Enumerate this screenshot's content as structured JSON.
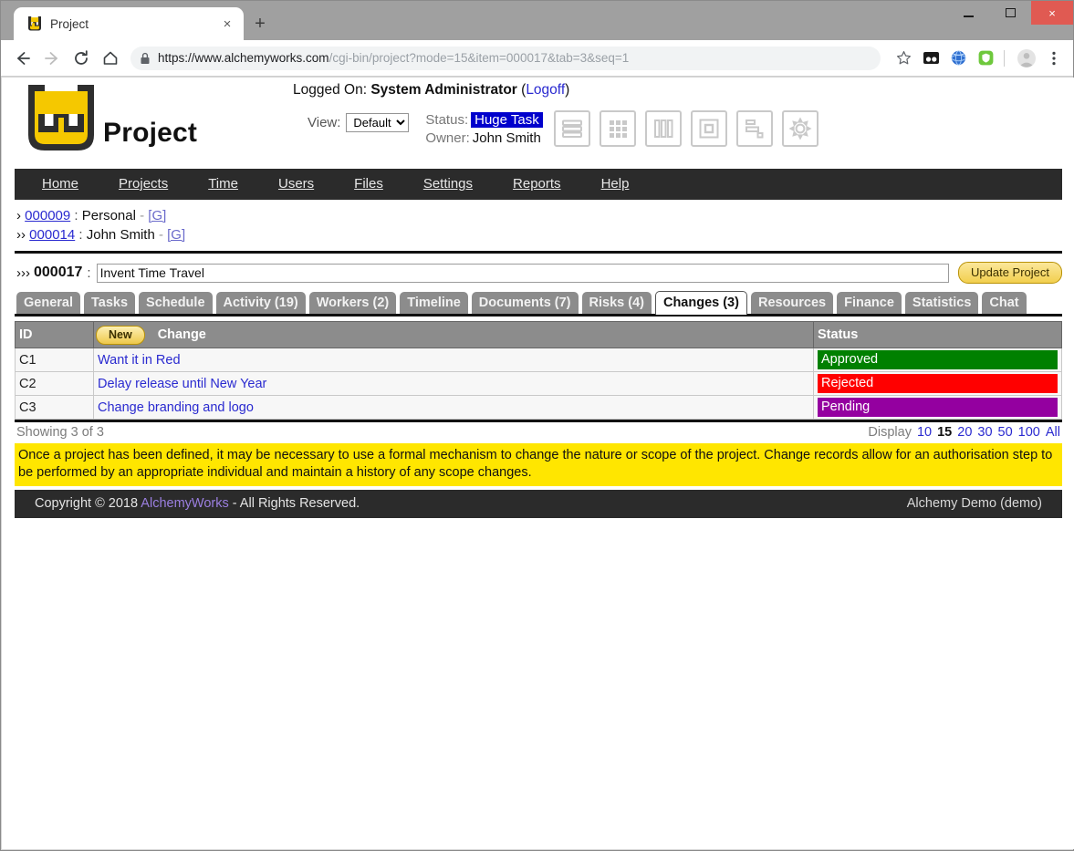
{
  "browser": {
    "tab_title": "Project",
    "tab_favicon": "project-logo-icon",
    "close_tab_label": "×",
    "new_tab_label": "+",
    "window_minimize": "minimize-icon",
    "window_maximize": "maximize-icon",
    "window_close": "×",
    "back_label": "←",
    "forward_label": "→",
    "reload_label": "⟳",
    "home_label": "⌂",
    "url_secure": "https://www.alchemyworks.com",
    "url_path": "/cgi-bin/project?mode=15&item=000017&tab=3&seq=1",
    "bookmark_label": "☆",
    "menu_label": "⋮"
  },
  "header": {
    "logo_text": "Project",
    "logged_on_label": "Logged On:",
    "user_name": "System Administrator",
    "logoff_open": "(",
    "logoff_label": "Logoff",
    "logoff_close": ")",
    "view_label": "View:",
    "view_value": "Default",
    "view_options": [
      "Default"
    ],
    "status_label": "Status:",
    "status_value": "Huge Task",
    "status_color": "#0000CC",
    "owner_label": "Owner:",
    "owner_value": "John Smith",
    "view_icons": [
      "list-view-icon",
      "grid-view-icon",
      "column-view-icon",
      "box-view-icon",
      "gantt-view-icon",
      "settings-gear-icon"
    ]
  },
  "nav": {
    "items": [
      {
        "label": "Home"
      },
      {
        "label": "Projects"
      },
      {
        "label": "Time"
      },
      {
        "label": "Users"
      },
      {
        "label": "Files"
      },
      {
        "label": "Settings"
      },
      {
        "label": "Reports"
      },
      {
        "label": "Help"
      }
    ]
  },
  "breadcrumbs": [
    {
      "arrow": "›",
      "id": "000009",
      "sep": ":",
      "name": "Personal",
      "dash": "-",
      "group": "[G]"
    },
    {
      "arrow": "››",
      "id": "000014",
      "sep": ":",
      "name": "John Smith",
      "dash": "-",
      "group": "[G]"
    }
  ],
  "project": {
    "chevron": "›››",
    "id": "000017",
    "sep": ":",
    "name_value": "Invent Time Travel",
    "name_placeholder": "",
    "update_button": "Update Project"
  },
  "tabs": [
    {
      "label": "General",
      "active": false
    },
    {
      "label": "Tasks",
      "active": false
    },
    {
      "label": "Schedule",
      "active": false
    },
    {
      "label": "Activity (19)",
      "active": false
    },
    {
      "label": "Workers (2)",
      "active": false
    },
    {
      "label": "Timeline",
      "active": false
    },
    {
      "label": "Documents (7)",
      "active": false
    },
    {
      "label": "Risks (4)",
      "active": false
    },
    {
      "label": "Changes (3)",
      "active": true
    },
    {
      "label": "Resources",
      "active": false
    },
    {
      "label": "Finance",
      "active": false
    },
    {
      "label": "Statistics",
      "active": false
    },
    {
      "label": "Chat",
      "active": false
    }
  ],
  "table": {
    "col_id": "ID",
    "new_button": "New",
    "col_change": "Change",
    "col_status": "Status",
    "rows": [
      {
        "id": "C1",
        "change": "Want it in Red",
        "status": "Approved",
        "status_color": "#008000"
      },
      {
        "id": "C2",
        "change": "Delay release until New Year",
        "status": "Rejected",
        "status_color": "#FF0000"
      },
      {
        "id": "C3",
        "change": "Change branding and logo",
        "status": "Pending",
        "status_color": "#9400A0"
      }
    ],
    "showing": "Showing 3 of 3",
    "display_label": "Display",
    "display_options": [
      {
        "label": "10",
        "current": false
      },
      {
        "label": "15",
        "current": true
      },
      {
        "label": "20",
        "current": false
      },
      {
        "label": "30",
        "current": false
      },
      {
        "label": "50",
        "current": false
      },
      {
        "label": "100",
        "current": false
      },
      {
        "label": "All",
        "current": false
      }
    ]
  },
  "info_banner": "Once a project has been defined, it may be necessary to use a formal mechanism to change the nature or scope of the project. Change records allow for an authorisation step to be performed by an appropriate individual and maintain a history of any scope changes.",
  "footer": {
    "copyright_pre": "Copyright © 2018",
    "brand": "AlchemyWorks",
    "copyright_post": "- All Rights Reserved.",
    "right": "Alchemy Demo (demo)"
  }
}
